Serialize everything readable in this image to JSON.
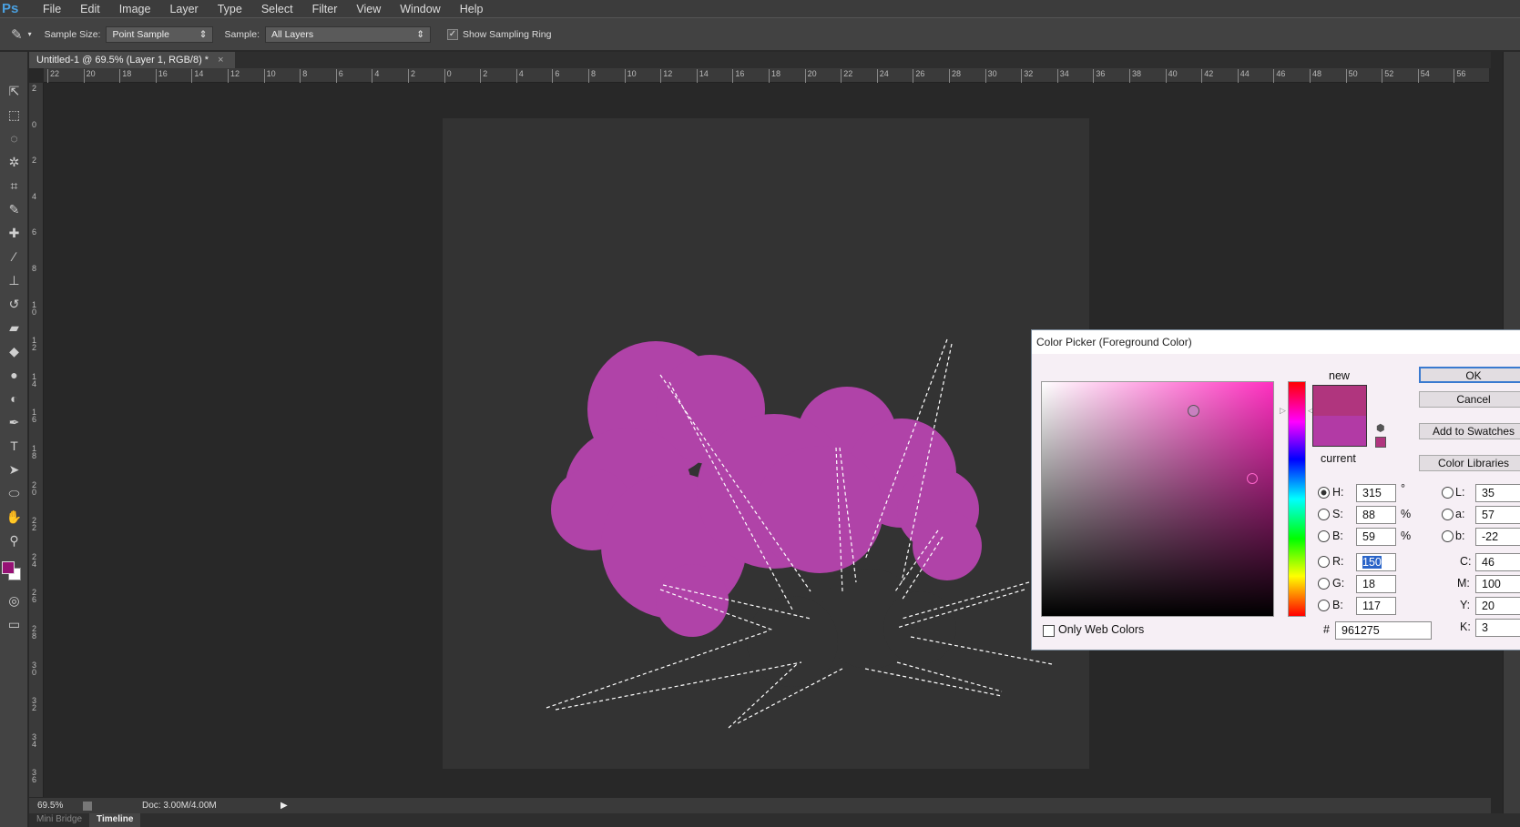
{
  "app": {
    "logo": "Ps"
  },
  "menu": [
    "File",
    "Edit",
    "Image",
    "Layer",
    "Type",
    "Select",
    "Filter",
    "View",
    "Window",
    "Help"
  ],
  "options": {
    "tool_icon": "eyedropper-icon",
    "sample_size_label": "Sample Size:",
    "sample_size_value": "Point Sample",
    "sample_label": "Sample:",
    "sample_value": "All Layers",
    "show_ring_label": "Show Sampling Ring",
    "show_ring_checked": true
  },
  "document_tab": {
    "title": "Untitled-1 @ 69.5% (Layer 1, RGB/8) *",
    "close": "×"
  },
  "rulers": {
    "horizontal": [
      "22",
      "20",
      "18",
      "16",
      "14",
      "12",
      "10",
      "8",
      "6",
      "4",
      "2",
      "0",
      "2",
      "4",
      "6",
      "8",
      "10",
      "12",
      "14",
      "16",
      "18",
      "20",
      "22",
      "24",
      "26",
      "28",
      "30",
      "32",
      "34",
      "36",
      "38",
      "40",
      "42",
      "44",
      "46",
      "48",
      "50",
      "52",
      "54",
      "56"
    ],
    "vertical": [
      "2",
      "0",
      "2",
      "4",
      "6",
      "8",
      "1 0",
      "1 2",
      "1 4",
      "1 6",
      "1 8",
      "2 0",
      "2 2",
      "2 4",
      "2 6",
      "2 8",
      "3 0",
      "3 2",
      "3 4",
      "3 6"
    ]
  },
  "status": {
    "zoom": "69.5%",
    "doc": "Doc: 3.00M/4.00M"
  },
  "bottom_tabs": [
    "Mini Bridge",
    "Timeline"
  ],
  "colors": {
    "foreground": "#961275",
    "shape": "#b043a8",
    "canvas": "#333333"
  },
  "color_picker": {
    "title": "Color Picker (Foreground Color)",
    "new_label": "new",
    "current_label": "current",
    "new_color": "#b0357e",
    "current_color": "#b23aa5",
    "buttons": {
      "ok": "OK",
      "cancel": "Cancel",
      "add": "Add to Swatches",
      "libraries": "Color Libraries"
    },
    "hsb": [
      {
        "label": "H:",
        "value": "315",
        "unit": "°",
        "selected": true
      },
      {
        "label": "S:",
        "value": "88",
        "unit": "%"
      },
      {
        "label": "B:",
        "value": "59",
        "unit": "%"
      }
    ],
    "rgb": [
      {
        "label": "R:",
        "value": "150"
      },
      {
        "label": "G:",
        "value": "18"
      },
      {
        "label": "B:",
        "value": "117"
      }
    ],
    "lab": [
      {
        "label": "L:",
        "value": "35"
      },
      {
        "label": "a:",
        "value": "57"
      },
      {
        "label": "b:",
        "value": "-22"
      }
    ],
    "cmyk": [
      {
        "label": "C:",
        "value": "46"
      },
      {
        "label": "M:",
        "value": "100"
      },
      {
        "label": "Y:",
        "value": "20"
      },
      {
        "label": "K:",
        "value": "3"
      }
    ],
    "hex_label": "#",
    "hex": "961275",
    "only_web_label": "Only Web Colors",
    "only_web_checked": false
  }
}
